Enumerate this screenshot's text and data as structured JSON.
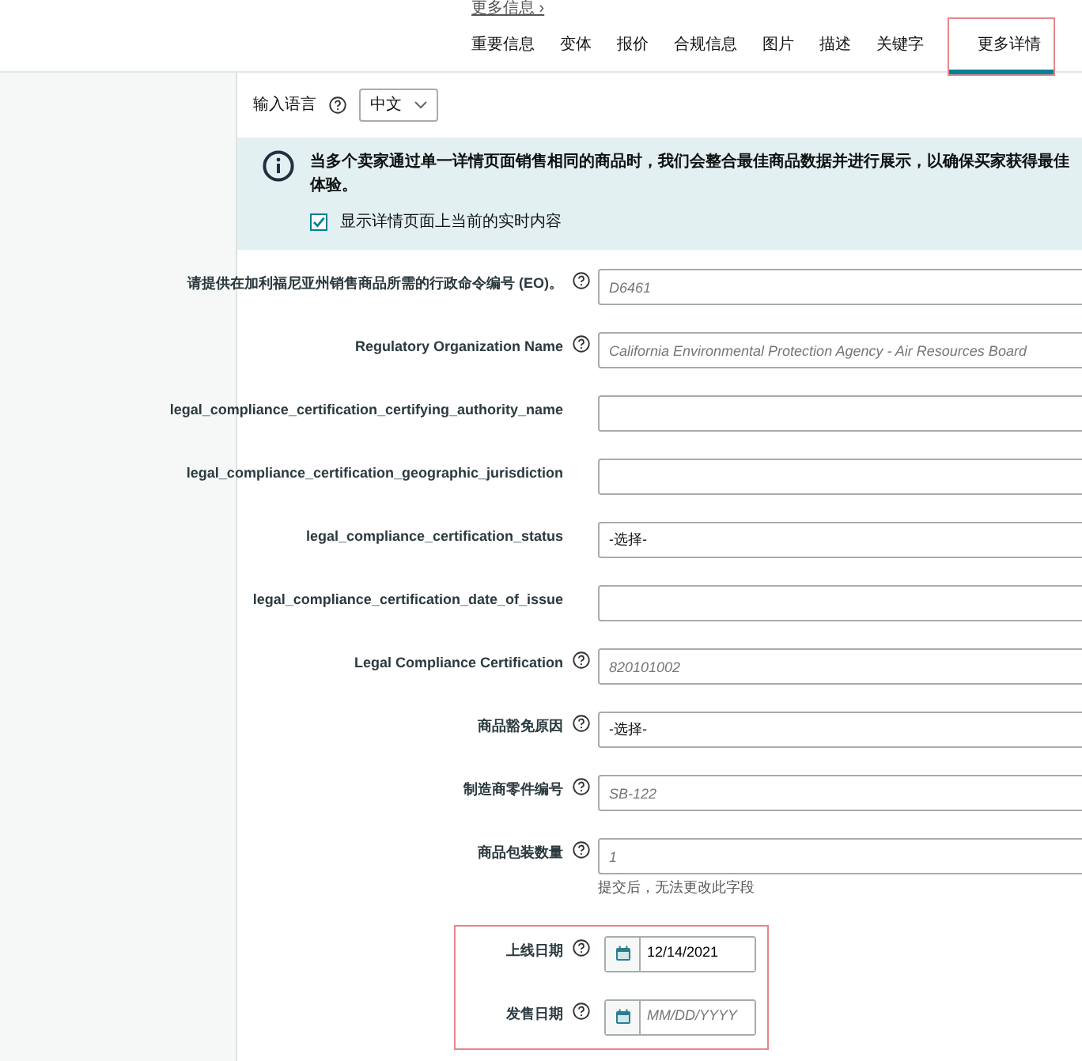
{
  "top_link": {
    "label": "更多信息",
    "chevron": "›"
  },
  "tabs": [
    {
      "label": "重要信息",
      "selected": false
    },
    {
      "label": "变体",
      "selected": false
    },
    {
      "label": "报价",
      "selected": false
    },
    {
      "label": "合规信息",
      "selected": false
    },
    {
      "label": "图片",
      "selected": false
    },
    {
      "label": "描述",
      "selected": false
    },
    {
      "label": "关键字",
      "selected": false
    },
    {
      "label": "更多详情",
      "selected": true,
      "highlighted": true
    }
  ],
  "language": {
    "label": "输入语言",
    "value": "中文"
  },
  "notice": {
    "text": "当多个卖家通过单一详情页面销售相同的商品时，我们会整合最佳商品数据并进行展示，以确保买家获得最佳体验。",
    "checkbox_label": "显示详情页面上当前的实时内容",
    "checked": true
  },
  "fields": [
    {
      "kind": "text",
      "label": "请提供在加利福尼亚州销售商品所需的行政命令编号 (EO)。",
      "help": true,
      "placeholder": "D6461"
    },
    {
      "kind": "text",
      "label": "Regulatory Organization Name",
      "help": true,
      "placeholder": "California Environmental Protection Agency - Air Resources Board"
    },
    {
      "kind": "text",
      "label": "legal_compliance_certification_certifying_authority_name",
      "help": false
    },
    {
      "kind": "text",
      "label": "legal_compliance_certification_geographic_jurisdiction",
      "help": false
    },
    {
      "kind": "select",
      "label": "legal_compliance_certification_status",
      "help": false,
      "value": "-选择-"
    },
    {
      "kind": "text",
      "label": "legal_compliance_certification_date_of_issue",
      "help": false
    },
    {
      "kind": "text",
      "label": "Legal Compliance Certification",
      "help": true,
      "placeholder": "820101002"
    },
    {
      "kind": "select",
      "label": "商品豁免原因",
      "help": true,
      "value": "-选择-"
    },
    {
      "kind": "text",
      "label": "制造商零件编号",
      "help": true,
      "placeholder": "SB-122"
    },
    {
      "kind": "text",
      "label": "商品包装数量",
      "help": true,
      "placeholder": "1",
      "note": "提交后，无法更改此字段"
    }
  ],
  "date_fields": [
    {
      "label": "上线日期",
      "help": true,
      "value": "12/14/2021"
    },
    {
      "label": "发售日期",
      "help": true,
      "placeholder": "MM/DD/YYYY"
    }
  ],
  "date_fields_highlighted": true
}
